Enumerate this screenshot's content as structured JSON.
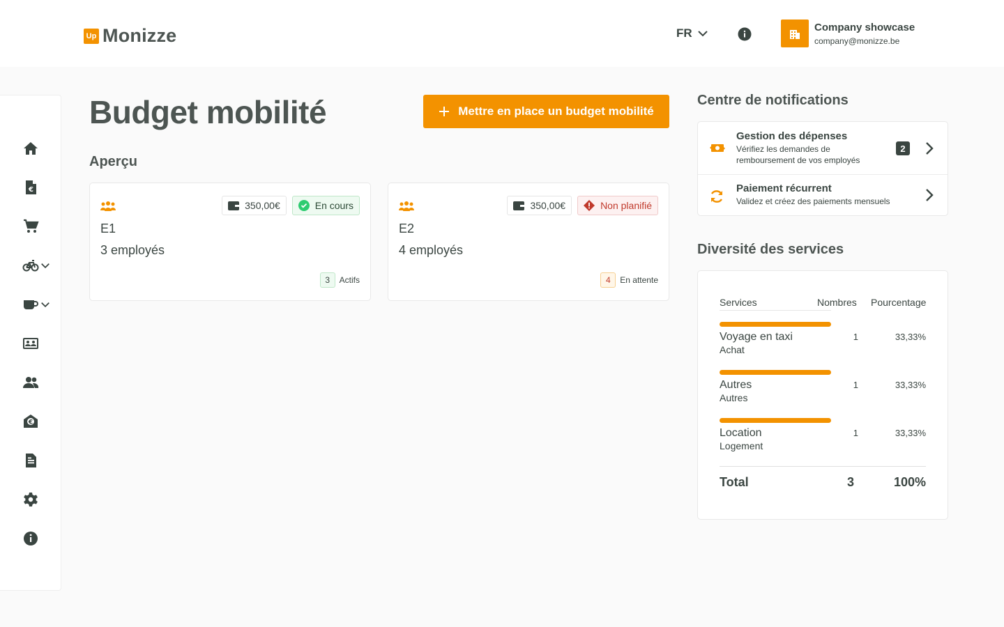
{
  "header": {
    "logo_badge": "Up",
    "logo_text": "Monizze",
    "language": "FR",
    "company_name": "Company showcase",
    "company_email": "company@monizze.be"
  },
  "sidebar": {
    "items": [
      {
        "icon": "home-icon"
      },
      {
        "icon": "euro-document-icon"
      },
      {
        "icon": "cart-icon"
      },
      {
        "icon": "bicycle-icon",
        "dropdown": true
      },
      {
        "icon": "coffee-cup-icon",
        "dropdown": true
      },
      {
        "icon": "id-card-icon"
      },
      {
        "icon": "users-icon"
      },
      {
        "icon": "euro-envelope-icon"
      },
      {
        "icon": "document-icon"
      },
      {
        "icon": "gear-icon"
      },
      {
        "icon": "info-icon"
      }
    ]
  },
  "main": {
    "title": "Budget mobilité",
    "cta_label": "Mettre en place un budget mobilité",
    "overview_title": "Aperçu",
    "cards": [
      {
        "name": "E1",
        "employees": "3 employés",
        "amount": "350,00€",
        "status": "En cours",
        "status_type": "ok",
        "count": "3",
        "count_label": "Actifs"
      },
      {
        "name": "E2",
        "employees": "4 employés",
        "amount": "350,00€",
        "status": "Non planifié",
        "status_type": "warn",
        "count": "4",
        "count_label": "En attente"
      }
    ]
  },
  "notifications": {
    "title": "Centre de notifications",
    "items": [
      {
        "title": "Gestion des dépenses",
        "description": "Vérifiez les demandes de remboursement de vos employés",
        "badge": "2"
      },
      {
        "title": "Paiement récurrent",
        "description": "Validez et créez des paiements mensuels"
      }
    ]
  },
  "diversity": {
    "title": "Diversité des services",
    "headers": {
      "services": "Services",
      "numbers": "Nombres",
      "percentage": "Pourcentage"
    },
    "rows": [
      {
        "name": "Voyage en taxi",
        "category": "Achat",
        "count": "1",
        "percent": "33,33%",
        "share": 0.3333
      },
      {
        "name": "Autres",
        "category": "Autres",
        "count": "1",
        "percent": "33,33%",
        "share": 0.3333
      },
      {
        "name": "Location",
        "category": "Logement",
        "count": "1",
        "percent": "33,33%",
        "share": 0.3333
      }
    ],
    "total_label": "Total",
    "total_count": "3",
    "total_percent": "100%"
  },
  "colors": {
    "brand": "#f39200",
    "text": "#3a4541",
    "success": "#2ecc71",
    "danger": "#c0392b"
  }
}
